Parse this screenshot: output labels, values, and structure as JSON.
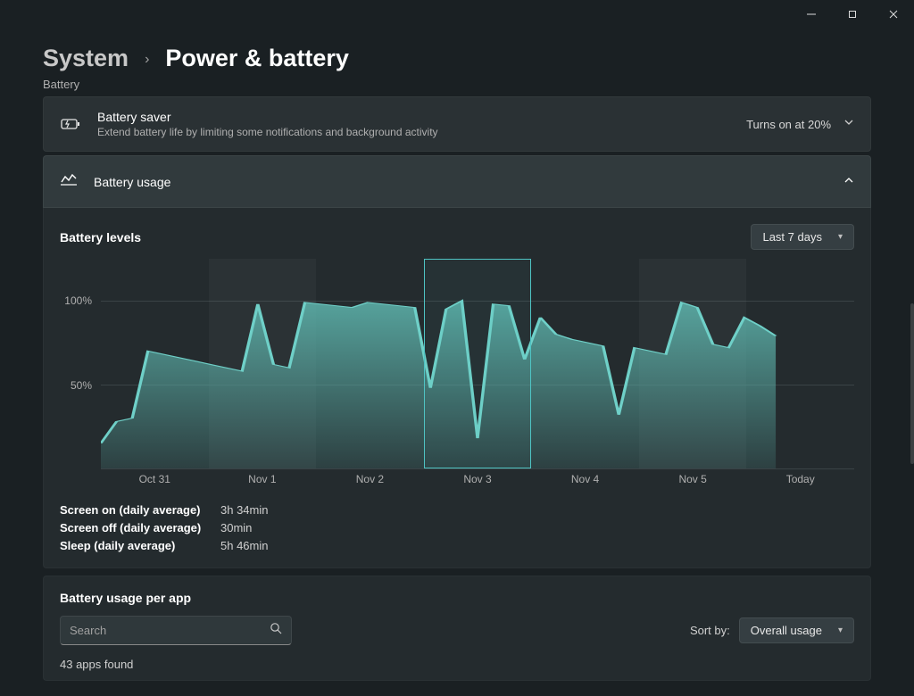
{
  "window": {
    "breadcrumb_parent": "System",
    "breadcrumb_page": "Power & battery",
    "section_label_cut": "Battery"
  },
  "battery_saver": {
    "title": "Battery saver",
    "desc": "Extend battery life by limiting some notifications and background activity",
    "value": "Turns on at 20%"
  },
  "usage": {
    "header_title": "Battery usage",
    "levels_title": "Battery levels",
    "range_dropdown": "Last 7 days"
  },
  "chart_data": {
    "type": "area",
    "ylabel": "",
    "xlabel": "",
    "ylim": [
      0,
      125
    ],
    "yticks": [
      {
        "v": 50,
        "label": "50%"
      },
      {
        "v": 100,
        "label": "100%"
      }
    ],
    "categories": [
      "Oct 31",
      "Nov 1",
      "Nov 2",
      "Nov 3",
      "Nov 4",
      "Nov 5",
      "Today"
    ],
    "selected_index": 3,
    "weekend_indices": [
      1,
      5
    ],
    "series": [
      {
        "name": "battery",
        "values": [
          15,
          28,
          30,
          70,
          68,
          66,
          64,
          62,
          60,
          58,
          98,
          62,
          60,
          99,
          98,
          97,
          96,
          99,
          98,
          97,
          96,
          48,
          95,
          100,
          18,
          98,
          97,
          65,
          90,
          80,
          77,
          75,
          73,
          32,
          72,
          70,
          68,
          99,
          96,
          74,
          72,
          90,
          85,
          79,
          null,
          null,
          null,
          null,
          null
        ]
      }
    ]
  },
  "stats": {
    "rows": [
      {
        "label": "Screen on (daily average)",
        "value": "3h 34min"
      },
      {
        "label": "Screen off (daily average)",
        "value": "30min"
      },
      {
        "label": "Sleep (daily average)",
        "value": "5h 46min"
      }
    ]
  },
  "perapp": {
    "title": "Battery usage per app",
    "search_placeholder": "Search",
    "sort_label": "Sort by:",
    "sort_value": "Overall usage",
    "apps_found": "43 apps found"
  }
}
